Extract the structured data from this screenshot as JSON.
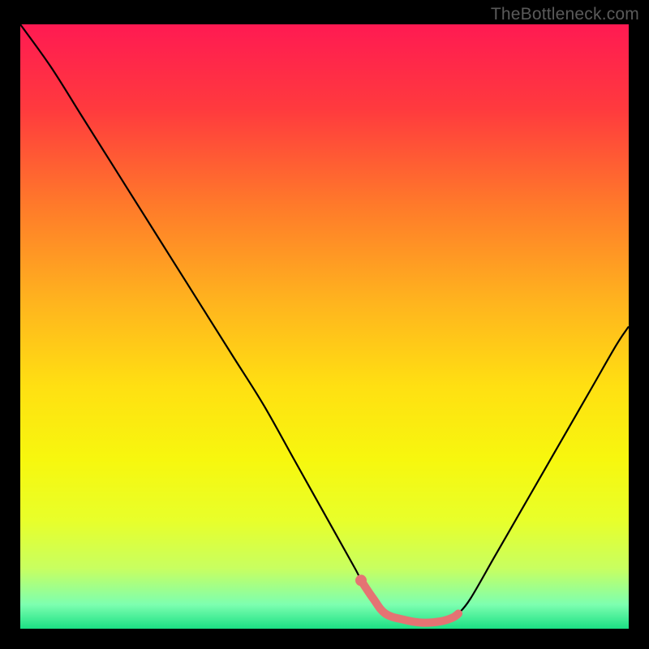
{
  "watermark": "TheBottleneck.com",
  "chart_data": {
    "type": "line",
    "title": "",
    "xlabel": "",
    "ylabel": "",
    "xlim": [
      0,
      100
    ],
    "ylim": [
      0,
      100
    ],
    "background_gradient": {
      "stops": [
        {
          "offset": 0.0,
          "color": "#ff1a52"
        },
        {
          "offset": 0.14,
          "color": "#ff3a3e"
        },
        {
          "offset": 0.3,
          "color": "#ff7a2a"
        },
        {
          "offset": 0.46,
          "color": "#ffb41e"
        },
        {
          "offset": 0.6,
          "color": "#ffe012"
        },
        {
          "offset": 0.72,
          "color": "#f7f70e"
        },
        {
          "offset": 0.82,
          "color": "#e8ff2a"
        },
        {
          "offset": 0.9,
          "color": "#c8ff60"
        },
        {
          "offset": 0.96,
          "color": "#7dffb0"
        },
        {
          "offset": 1.0,
          "color": "#1be084"
        }
      ]
    },
    "series": [
      {
        "name": "bottleneck-curve",
        "color": "#000000",
        "x": [
          0,
          5,
          10,
          15,
          20,
          25,
          30,
          35,
          40,
          45,
          50,
          55,
          56,
          58,
          60,
          63,
          66,
          69,
          71,
          72,
          74,
          78,
          82,
          86,
          90,
          94,
          98,
          100
        ],
        "values": [
          100,
          93,
          85,
          77,
          69,
          61,
          53,
          45,
          37,
          28,
          19,
          10,
          8,
          5,
          2.5,
          1.5,
          1,
          1.2,
          1.8,
          2.5,
          5,
          12,
          19,
          26,
          33,
          40,
          47,
          50
        ]
      }
    ],
    "highlight": {
      "name": "optimal-range",
      "color": "#e57373",
      "x": [
        56,
        58,
        60,
        63,
        66,
        69,
        71,
        72
      ],
      "values": [
        8,
        5,
        2.5,
        1.5,
        1,
        1.2,
        1.8,
        2.5
      ]
    },
    "highlight_marker": {
      "name": "optimal-start",
      "color": "#e57373",
      "x": 56,
      "value": 8
    }
  }
}
